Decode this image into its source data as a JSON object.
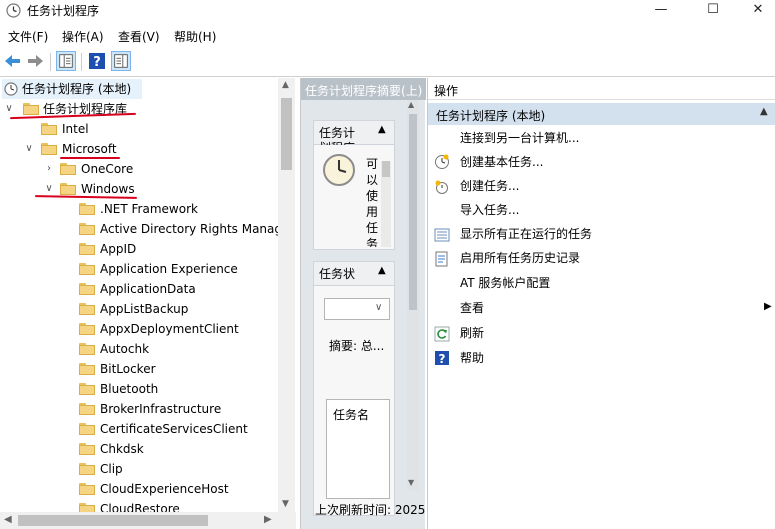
{
  "window": {
    "title": "任务计划程序",
    "minimize": "—",
    "maximize": "☐",
    "close": "✕"
  },
  "menu": [
    "文件(F)",
    "操作(A)",
    "查看(V)",
    "帮助(H)"
  ],
  "tree": {
    "root": "任务计划程序 (本地)",
    "library": "任务计划程序库",
    "intel": "Intel",
    "microsoft": "Microsoft",
    "onecore": "OneCore",
    "windows": "Windows",
    "items": [
      ".NET Framework",
      "Active Directory Rights Manage",
      "AppID",
      "Application Experience",
      "ApplicationData",
      "AppListBackup",
      "AppxDeploymentClient",
      "Autochk",
      "BitLocker",
      "Bluetooth",
      "BrokerInfrastructure",
      "CertificateServicesClient",
      "Chkdsk",
      "Clip",
      "CloudExperienceHost",
      "CloudRestore"
    ]
  },
  "middle": {
    "header": "任务计划程序摘要(上)",
    "panel1_title_line1": "任务计",
    "panel1_title_line2": "划程序",
    "panel1_text": [
      "可",
      "以",
      "使",
      "用",
      "任",
      "务"
    ],
    "panel2_title": "任务状",
    "summary_label": "摘要: 总...",
    "list_header": "任务名",
    "last_refresh": "上次刷新时间: 2025"
  },
  "actions": {
    "header": "操作",
    "section": "任务计划程序 (本地)",
    "items": [
      "连接到另一台计算机...",
      "创建基本任务...",
      "创建任务...",
      "导入任务...",
      "显示所有正在运行的任务",
      "启用所有任务历史记录",
      "AT 服务帐户配置",
      "查看",
      "刷新",
      "帮助"
    ]
  }
}
